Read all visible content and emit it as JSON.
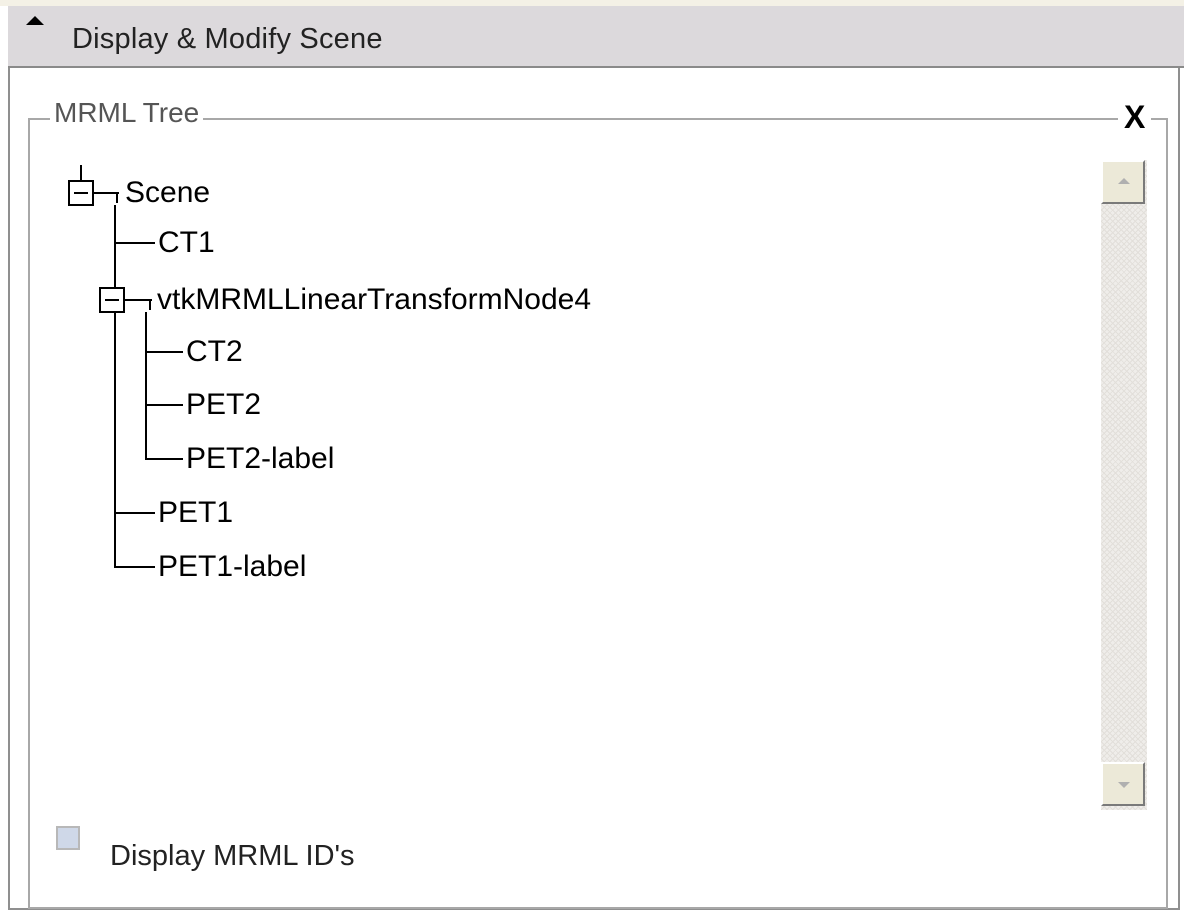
{
  "section": {
    "title": "Display & Modify Scene",
    "collapse_icon": "collapse-arrow-icon"
  },
  "mrml_tree": {
    "legend": "MRML Tree",
    "close_label": "X",
    "nodes": {
      "scene": "Scene",
      "ct1": "CT1",
      "transform": "vtkMRMLLinearTransformNode4",
      "ct2": "CT2",
      "pet2": "PET2",
      "pet2_label": "PET2-label",
      "pet1": "PET1",
      "pet1_label": "PET1-label"
    },
    "expanded": {
      "scene": true,
      "transform": true
    }
  },
  "options": {
    "display_ids_label": "Display MRML ID's",
    "display_ids_checked": false
  },
  "colors": {
    "header_bg": "#dcd9dc",
    "frame_border": "#a8a8a8",
    "tree_line": "#000000"
  }
}
